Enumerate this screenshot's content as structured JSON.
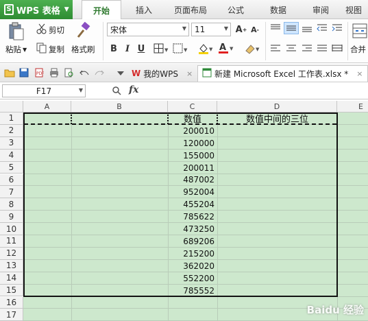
{
  "app": {
    "name": "WPS 表格",
    "logo_letter": "S"
  },
  "ribbon_tabs": [
    {
      "label": "开始",
      "active": true
    },
    {
      "label": "插入",
      "active": false
    },
    {
      "label": "页面布局",
      "active": false
    },
    {
      "label": "公式",
      "active": false
    },
    {
      "label": "数据",
      "active": false
    },
    {
      "label": "审阅",
      "active": false
    },
    {
      "label": "视图",
      "active": false
    }
  ],
  "ribbon": {
    "cut": "剪切",
    "paste": "粘贴",
    "copy": "复制",
    "format_painter": "格式刷",
    "font_name": "宋体",
    "font_size": "11",
    "merge": "合并"
  },
  "doc_tabs": [
    {
      "label": "我的WPS",
      "close": "×"
    },
    {
      "label": "新建 Microsoft Excel 工作表.xlsx *",
      "close": "×"
    }
  ],
  "formula_bar": {
    "cell_ref": "F17",
    "fx": "fx",
    "formula": ""
  },
  "columns": [
    "A",
    "B",
    "C",
    "D",
    "E"
  ],
  "rows": [
    "1",
    "2",
    "3",
    "4",
    "5",
    "6",
    "7",
    "8",
    "9",
    "10",
    "11",
    "12",
    "13",
    "14",
    "15",
    "16",
    "17"
  ],
  "sheet": {
    "c1": "数值",
    "d1": "数值中间的三位",
    "values": [
      "200010",
      "120000",
      "155000",
      "200011",
      "487002",
      "952004",
      "455204",
      "785622",
      "473250",
      "689206",
      "215200",
      "362020",
      "552200",
      "785552"
    ]
  },
  "watermark": "Baidu 经验"
}
